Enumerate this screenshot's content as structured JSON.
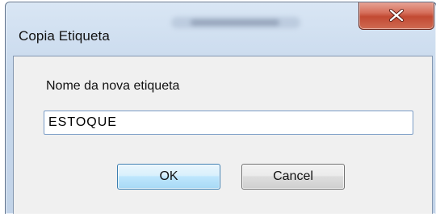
{
  "window": {
    "title": "Copia Etiqueta",
    "close_icon": "close-x-icon"
  },
  "dialog": {
    "field_label": "Nome da nova etiqueta",
    "input_value": "ESTOQUE",
    "ok_label": "OK",
    "cancel_label": "Cancel"
  },
  "colors": {
    "close_button": "#c94f37",
    "ok_button_border": "#3c7fb1",
    "input_border": "#7a9cc6",
    "client_background": "#f0f0f0"
  }
}
